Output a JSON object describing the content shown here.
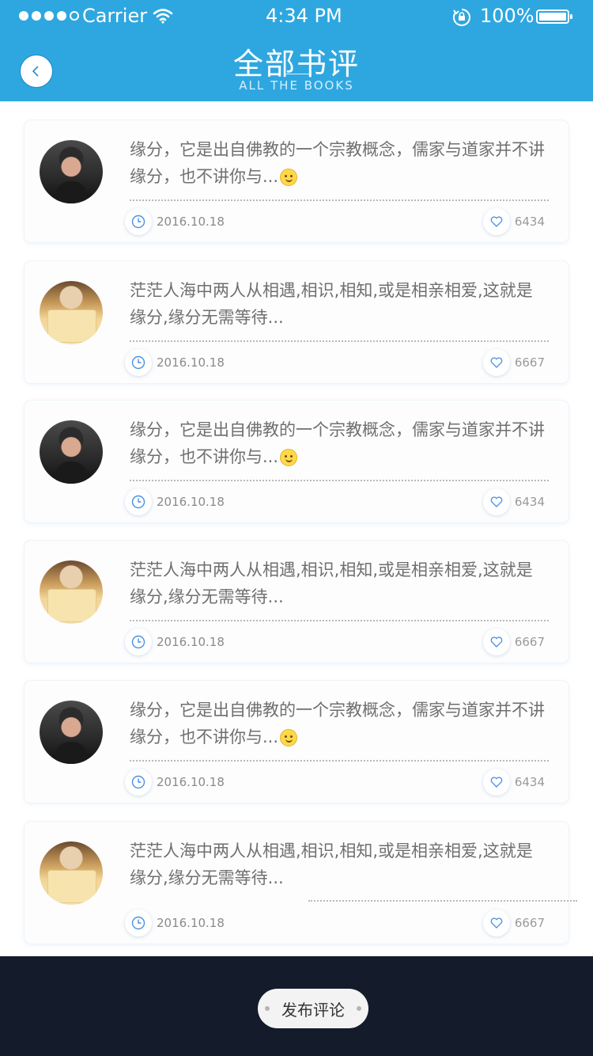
{
  "status_bar": {
    "carrier": "Carrier",
    "time": "4:34 PM",
    "battery": "100%"
  },
  "header": {
    "title": "全部书评",
    "subtitle": "ALL THE BOOKS"
  },
  "reviews": [
    {
      "avatar": "avatar-man",
      "text": "缘分，它是出自佛教的一个宗教概念，儒家与道家并不讲缘分，也不讲你与...",
      "has_emoji": true,
      "date": "2016.10.18",
      "likes": "6434"
    },
    {
      "avatar": "avatar-woman",
      "text": "茫茫人海中两人从相遇,相识,相知,或是相亲相爱,这就是缘分,缘分无需等待...",
      "has_emoji": false,
      "date": "2016.10.18",
      "likes": "6667"
    },
    {
      "avatar": "avatar-man",
      "text": "缘分，它是出自佛教的一个宗教概念，儒家与道家并不讲缘分，也不讲你与...",
      "has_emoji": true,
      "date": "2016.10.18",
      "likes": "6434"
    },
    {
      "avatar": "avatar-woman",
      "text": "茫茫人海中两人从相遇,相识,相知,或是相亲相爱,这就是缘分,缘分无需等待...",
      "has_emoji": false,
      "date": "2016.10.18",
      "likes": "6667"
    },
    {
      "avatar": "avatar-man",
      "text": "缘分，它是出自佛教的一个宗教概念，儒家与道家并不讲缘分，也不讲你与...",
      "has_emoji": true,
      "date": "2016.10.18",
      "likes": "6434"
    },
    {
      "avatar": "avatar-woman",
      "text": "茫茫人海中两人从相遇,相识,相知,或是相亲相爱,这就是缘分,缘分无需等待...",
      "has_emoji": false,
      "date": "2016.10.18",
      "likes": "6667"
    }
  ],
  "footer": {
    "publish_label": "发布评论"
  },
  "colors": {
    "header_bg": "#2ea7e0",
    "footer_bg": "#141b2b",
    "icon_blue": "#4a90e2"
  }
}
